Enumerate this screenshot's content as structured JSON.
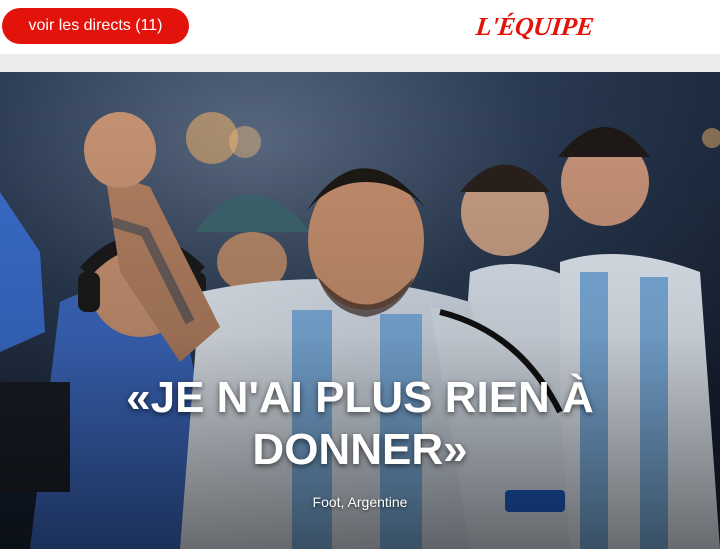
{
  "header": {
    "live_button_label": "voir les directs (11)",
    "logo_text": "L'ÉQUIPE"
  },
  "article": {
    "headline": "«JE N'AI PLUS RIEN À DONNER»",
    "tags": "Foot, Argentine",
    "image": {
      "description": "photo-messi-celebrating"
    }
  },
  "colors": {
    "brand_red": "#e3120b",
    "background": "#ffffff",
    "separator": "#ececec"
  }
}
